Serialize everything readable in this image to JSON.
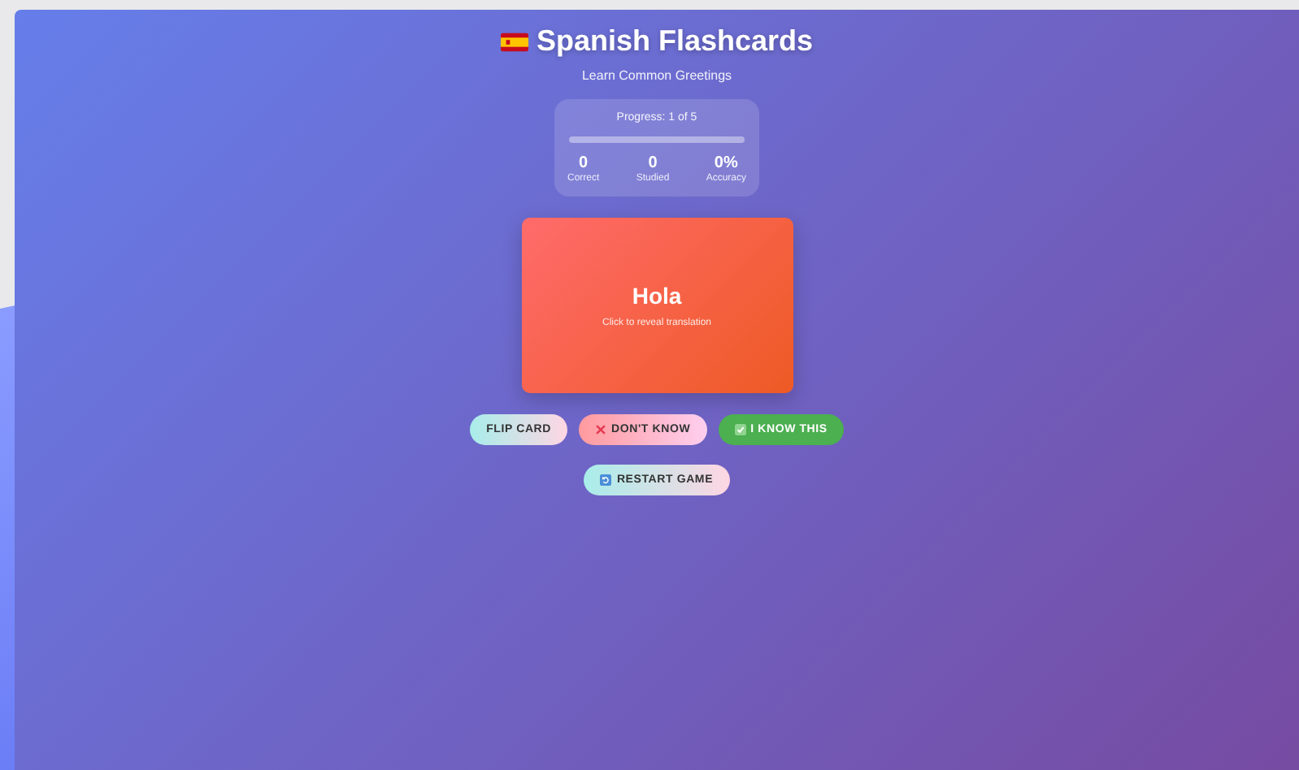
{
  "header": {
    "title": "Spanish Flashcards",
    "subtitle": "Learn Common Greetings"
  },
  "progress": {
    "label": "Progress: 1 of 5",
    "level": 0,
    "stats": [
      {
        "value": "0",
        "label": "Correct"
      },
      {
        "value": "0",
        "label": "Studied"
      },
      {
        "value": "0%",
        "label": "Accuracy"
      }
    ]
  },
  "card": {
    "word": "Hola",
    "hint": "Click to reveal translation"
  },
  "actions": [
    {
      "kind": "flip",
      "label": "FLIP CARD"
    },
    {
      "kind": "dont-know",
      "label": "DON'T KNOW"
    },
    {
      "kind": "know",
      "label": "I KNOW THIS"
    }
  ],
  "restart": {
    "label": "RESTART GAME"
  }
}
